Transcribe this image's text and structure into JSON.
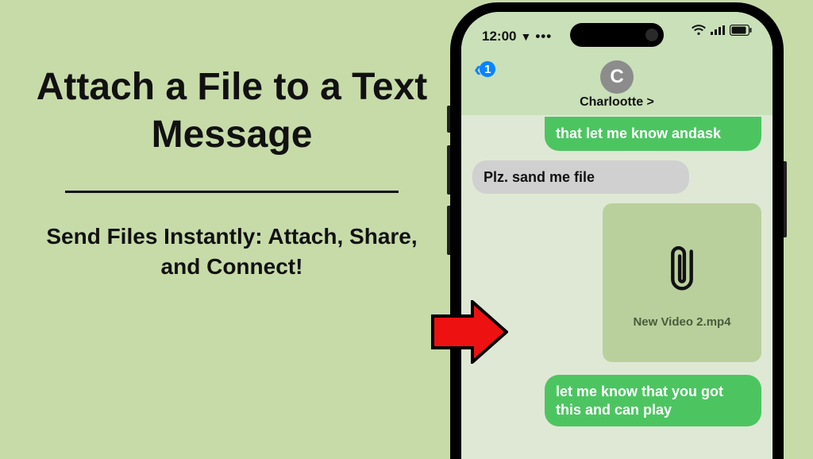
{
  "left": {
    "title": "Attach a File to a Text Message",
    "subtitle": "Send Files Instantly: Attach, Share, and Connect!"
  },
  "status": {
    "time": "12:00",
    "location_indicator": "▼",
    "more_dots": "•••"
  },
  "header": {
    "back_count": "1",
    "contact_initial": "C",
    "contact_name": "Charlootte  >"
  },
  "messages": {
    "sent1": "that let me know andask",
    "received1": "Plz. sand me file",
    "attachment_filename": "New Video 2.mp4",
    "sent2": "let me know that you got this and can play"
  }
}
